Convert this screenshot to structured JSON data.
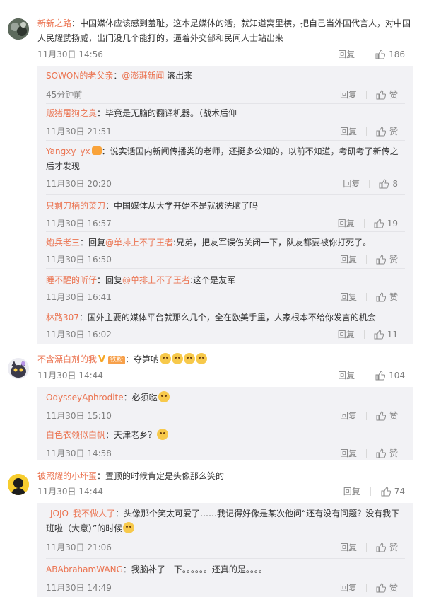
{
  "reply_label": "回复",
  "like_label": "赞",
  "comments": [
    {
      "user": "新新之路",
      "text": "：中国媒体应该感到羞耻，这本是媒体的活，就知道窝里横，把自己当外国代言人，对中国人民耀武扬威，出门没几个能打的，逼着外交部和民间人士站出来",
      "time": "11月30日 14:56",
      "likes": "186",
      "replies": [
        {
          "user": "SOWON的老父亲",
          "pre": "：",
          "mention": "@澎湃新闻",
          "text": " 滚出来",
          "time": "45分钟前",
          "likes": "赞"
        },
        {
          "user": "贩猪屠狗之臭",
          "text": "：毕竟是无脑的翻译机器。（战术后仰",
          "time": "11月30日 21:51",
          "likes": "赞"
        },
        {
          "user": "Yangxy_yx",
          "text": "：说实话国内新闻传播类的老师，还挺多公知的，以前不知道，考研考了新传之后才发现",
          "time": "11月30日 20:20",
          "likes": "8"
        },
        {
          "user": "只剩刀柄的菜刀",
          "text": "：中国媒体从大学开始不是就被洗脑了吗",
          "time": "11月30日 16:57",
          "likes": "19"
        },
        {
          "user": "炮兵老三",
          "pre": "：回复",
          "mention": "@单排上不了王者",
          "text": ":兄弟，把友军误伤关闭一下，队友都要被你打死了。",
          "time": "11月30日 16:50",
          "likes": "赞"
        },
        {
          "user": "睡不醒的昕仔",
          "pre": "：回复",
          "mention": "@单排上不了王者",
          "text": ":这个是友军",
          "time": "11月30日 16:41",
          "likes": "赞"
        },
        {
          "user": "林路307",
          "text": "：国外主要的媒体平台就那么几个，全在欧美手里，人家根本不给你发言的机会",
          "time": "11月30日 16:02",
          "likes": "11"
        }
      ]
    },
    {
      "user": "不含漂白剂的我",
      "badge_v": "V",
      "badge_fan": "铁粉",
      "text": "：夺笋呐",
      "time": "11月30日 14:44",
      "likes": "104",
      "replies": [
        {
          "user": "OdysseyAphrodite",
          "text": "：必须哒",
          "time": "11月30日 15:10",
          "likes": "赞"
        },
        {
          "user": "白色衣领似白帆",
          "text": "：天津老乡？",
          "time": "11月30日 14:58",
          "likes": "赞"
        }
      ]
    },
    {
      "user": "被照耀的小坏蛋",
      "text": "：置顶的时候肯定是头像那么笑的",
      "time": "11月30日 14:44",
      "likes": "74",
      "replies": [
        {
          "user": "_JOJO_我不做人了",
          "text": "：头像那个笑太可爱了……我记得好像是某次他问“还有没有问题？没有我下班啦（大意）”的时候",
          "time": "11月30日 21:06",
          "likes": "赞"
        },
        {
          "user": "ABAbrahamWANG",
          "text": "：我脑补了一下。。。。。。还真的是。。。。",
          "time": "11月30日 14:49",
          "likes": "赞"
        }
      ]
    }
  ]
}
